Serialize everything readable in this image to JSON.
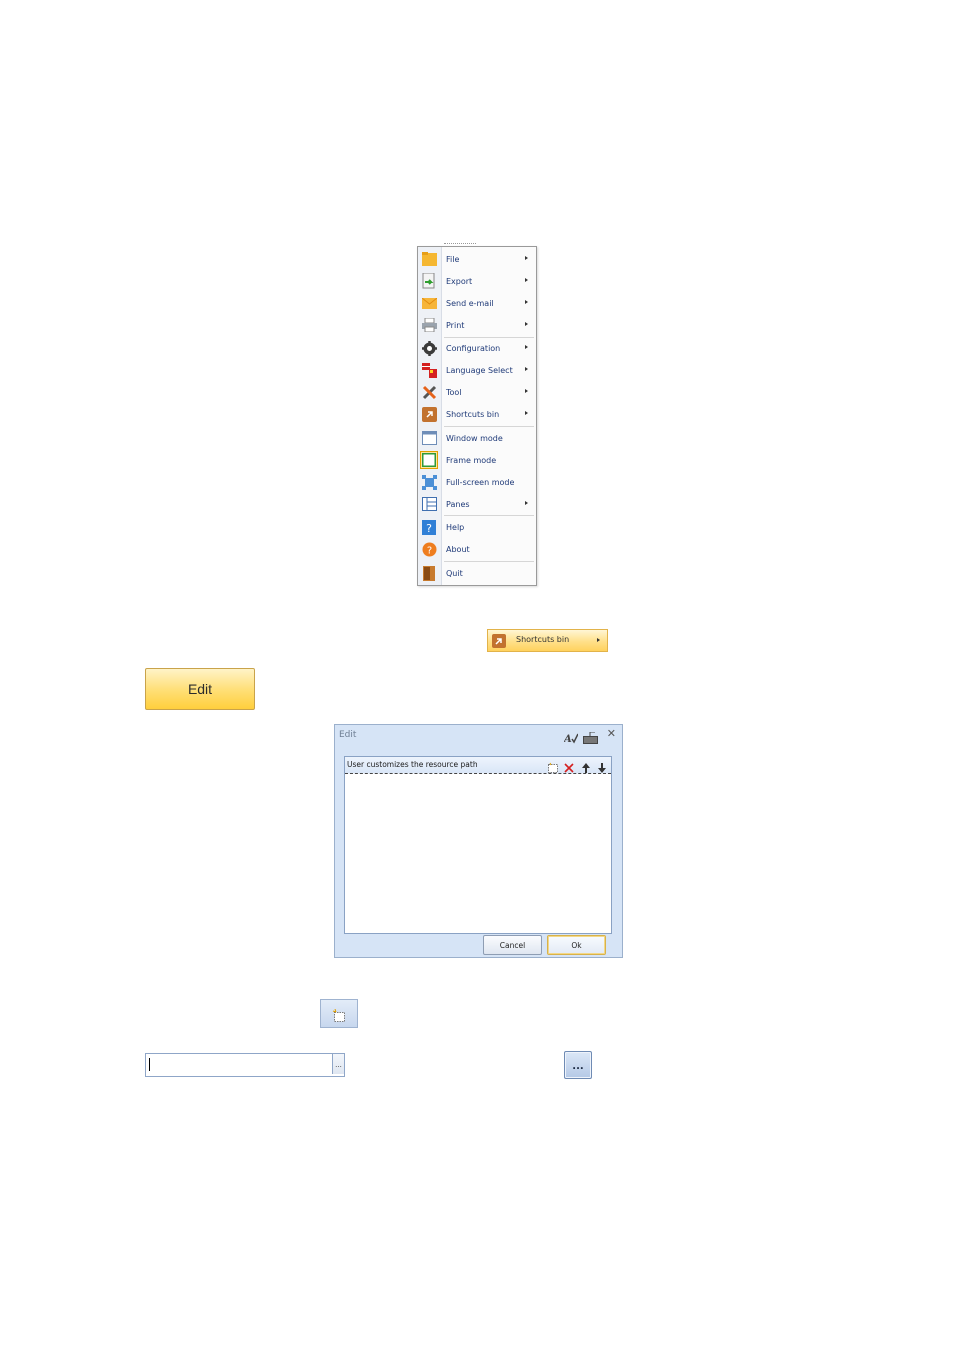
{
  "menu": {
    "items": [
      {
        "label": "File",
        "icon": "folder-icon",
        "submenu": true
      },
      {
        "label": "Export",
        "icon": "export-icon",
        "submenu": true
      },
      {
        "label": "Send e-mail",
        "icon": "envelope-icon",
        "submenu": true
      },
      {
        "label": "Print",
        "icon": "printer-icon",
        "submenu": true
      },
      {
        "label": "Configuration",
        "icon": "gear-icon",
        "submenu": true
      },
      {
        "label": "Language Select",
        "icon": "flag-icon",
        "submenu": true
      },
      {
        "label": "Tool",
        "icon": "tools-icon",
        "submenu": true
      },
      {
        "label": "Shortcuts bin",
        "icon": "shortcut-icon",
        "submenu": true
      },
      {
        "label": "Window mode",
        "icon": "window-icon",
        "submenu": false
      },
      {
        "label": "Frame mode",
        "icon": "frame-icon",
        "submenu": false
      },
      {
        "label": "Full-screen mode",
        "icon": "fullscreen-icon",
        "submenu": false
      },
      {
        "label": "Panes",
        "icon": "panes-icon",
        "submenu": true
      },
      {
        "label": "Help",
        "icon": "help-icon",
        "submenu": false
      },
      {
        "label": "About",
        "icon": "about-icon",
        "submenu": false
      },
      {
        "label": "Quit",
        "icon": "door-icon",
        "submenu": false
      }
    ]
  },
  "shortcuts_bin_item": {
    "label": "Shortcuts bin"
  },
  "edit_button": {
    "label": "Edit"
  },
  "dialog": {
    "title": "Edit",
    "panel_header": "User customizes the resource path",
    "cancel_label": "Cancel",
    "ok_label": "Ok"
  },
  "path_field": {
    "value": "",
    "browse_label": "..."
  },
  "browse_button": {
    "label": "..."
  },
  "colors": {
    "accent": "#ffd25e",
    "dialog_bg": "#d6e4f6",
    "menu_text": "#1f3a78"
  }
}
